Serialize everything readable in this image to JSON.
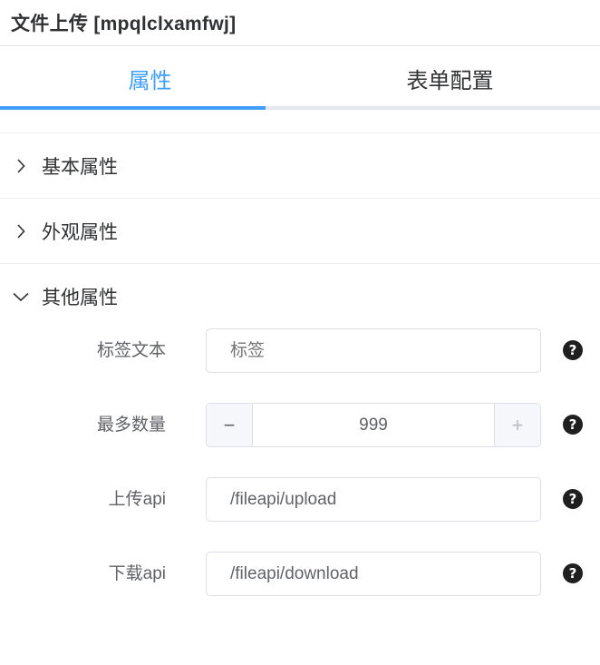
{
  "header": {
    "title": "文件上传 [mpqlclxamfwj]"
  },
  "tabs": [
    {
      "label": "属性",
      "active": true
    },
    {
      "label": "表单配置",
      "active": false
    }
  ],
  "sections": [
    {
      "title": "基本属性",
      "expanded": false,
      "icon": "chevron-right-icon"
    },
    {
      "title": "外观属性",
      "expanded": false,
      "icon": "chevron-right-icon"
    },
    {
      "title": "其他属性",
      "expanded": true,
      "icon": "chevron-down-icon"
    }
  ],
  "form": {
    "label_text": {
      "label": "标签文本",
      "placeholder": "标签",
      "value": ""
    },
    "max_count": {
      "label": "最多数量",
      "value": "999",
      "minus": "−",
      "plus": "+"
    },
    "upload_api": {
      "label": "上传api",
      "value": "/fileapi/upload"
    },
    "download_api": {
      "label": "下载api",
      "value": "/fileapi/download"
    },
    "help_glyph": "?"
  },
  "colors": {
    "accent": "#409eff",
    "border": "#dcdfe6",
    "text": "#303133",
    "muted": "#606266"
  }
}
